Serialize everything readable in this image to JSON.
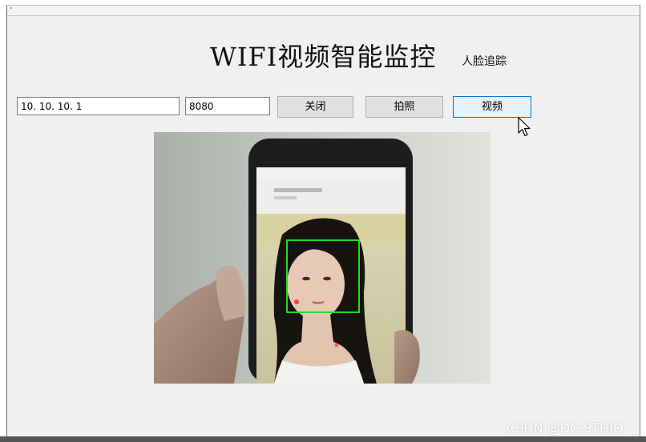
{
  "window": {
    "title": "WIFI视频智能监控",
    "subtitle": "人脸追踪"
  },
  "connection": {
    "ip_value": "10. 10. 10. 1",
    "port_value": "8080"
  },
  "buttons": {
    "close_label": "关闭",
    "photo_label": "拍照",
    "video_label": "视频"
  },
  "video_feed": {
    "face_box_color": "#22dd22",
    "camera_frame_icon": "camera-frame"
  },
  "watermark": "CSDN @DC-STDIO",
  "colors": {
    "window_bg": "#f0f0f0",
    "button_bg": "#e1e1e1",
    "focused_button_border": "#0078d7"
  }
}
